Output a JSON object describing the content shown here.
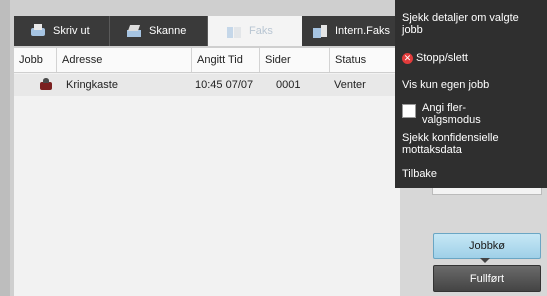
{
  "tabs": [
    {
      "label": "Skriv ut",
      "icon": "printer-icon"
    },
    {
      "label": "Skanne",
      "icon": "scanner-icon"
    },
    {
      "label": "Faks",
      "icon": "fax-icon",
      "active": true
    },
    {
      "label": "Intern.Faks",
      "icon": "internet-fax-icon"
    }
  ],
  "table": {
    "headers": [
      "Jobb",
      "Adresse",
      "Angitt Tid",
      "Sider",
      "Status"
    ],
    "rows": [
      {
        "address": "Kringkaste",
        "time": "10:45 07/07",
        "pages": "0001",
        "status": "Venter"
      }
    ]
  },
  "menu": {
    "items": [
      {
        "label": "Sjekk detaljer om valgte jobb"
      },
      {
        "label": "Stopp/slett"
      },
      {
        "label": "Vis kun egen jobb"
      },
      {
        "label": "Angi fler-valgsmodus"
      },
      {
        "label": "Sjekk konfidensielle mottaksdata"
      },
      {
        "label": "Tilbake"
      }
    ]
  },
  "buttons": {
    "queue": "Jobbkø",
    "done": "Fullført"
  }
}
